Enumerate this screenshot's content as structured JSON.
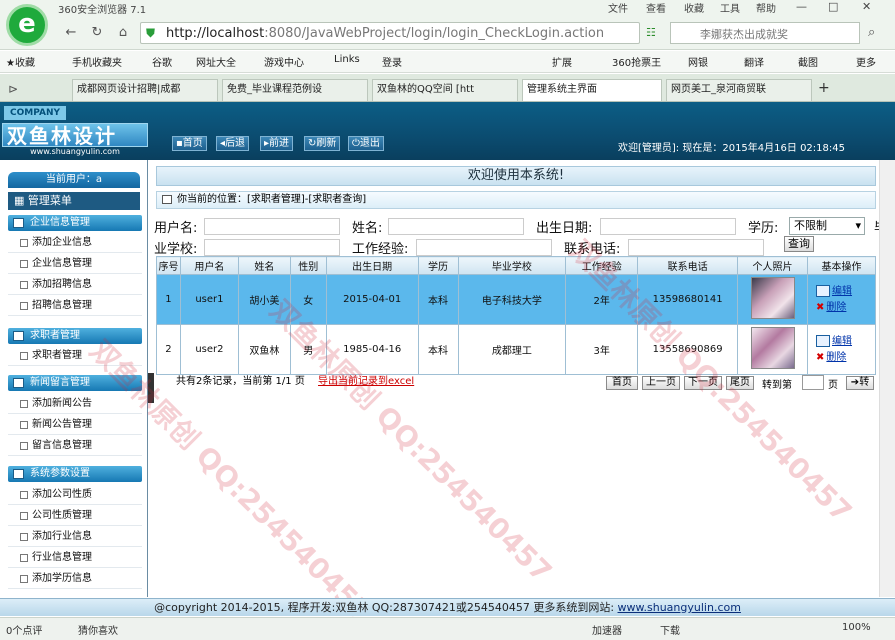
{
  "browser": {
    "title": "360安全浏览器 7.1",
    "menus": [
      "文件",
      "查看",
      "收藏",
      "工具",
      "帮助"
    ],
    "url_host": "http://localhost",
    "url_rest": ":8080/JavaWebProject/login/login_CheckLogin.action",
    "search_text": "李娜获杰出成就奖",
    "favorites": [
      "收藏",
      "手机收藏夹",
      "谷歌",
      "网址大全",
      "游戏中心",
      "Links",
      "登录",
      "扩展",
      "360抢票王",
      "网银",
      "翻译",
      "截图",
      "更多"
    ],
    "tabs": [
      "成都网页设计招聘|成都",
      "免费_毕业课程范例设",
      "双鱼林的QQ空间 [htt",
      "管理系统主界面",
      "网页美工_泉河商贸联"
    ],
    "status": {
      "left1": "0个点评",
      "left2": "猜你喜欢",
      "accel": "加速器",
      "download": "下载",
      "zoom": "100%"
    }
  },
  "header": {
    "company_tag": "COMPANY",
    "brand": "双鱼林设计",
    "brand_url": "www.shuangyulin.com",
    "nav": [
      "首页",
      "后退",
      "前进",
      "刷新",
      "退出"
    ],
    "welcome": "欢迎[管理员]:    现在是：2015年4月16日 02:18:45"
  },
  "sidebar": {
    "current_user": "当前用户：a",
    "menu_title": "管理菜单",
    "groups": [
      {
        "title": "企业信息管理",
        "items": [
          "添加企业信息",
          "企业信息管理",
          "添加招聘信息",
          "招聘信息管理"
        ]
      },
      {
        "title": "求职者管理",
        "items": [
          "求职者管理"
        ]
      },
      {
        "title": "新闻留言管理",
        "items": [
          "添加新闻公告",
          "新闻公告管理",
          "留言信息管理"
        ]
      },
      {
        "title": "系统参数设置",
        "items": [
          "添加公司性质",
          "公司性质管理",
          "添加行业信息",
          "行业信息管理",
          "添加学历信息"
        ]
      }
    ]
  },
  "main": {
    "banner": "欢迎使用本系统!",
    "crumb": "你当前的位置：[求职者管理]-[求职者查询]",
    "filters": {
      "username": "用户名:",
      "name": "姓名:",
      "birth": "出生日期:",
      "edu": "学历:",
      "edu_value": "不限制",
      "school_a": "毕",
      "school_b": "业学校:",
      "exp": "工作经验:",
      "phone": "联系电话:",
      "query": "查询"
    },
    "columns": [
      "序号",
      "用户名",
      "姓名",
      "性别",
      "出生日期",
      "学历",
      "毕业学校",
      "工作经验",
      "联系电话",
      "个人照片",
      "基本操作"
    ],
    "rows": [
      {
        "no": "1",
        "username": "user1",
        "name": "胡小美",
        "gender": "女",
        "birth": "2015-04-01",
        "edu": "本科",
        "school": "电子科技大学",
        "exp": "2年",
        "phone": "13598680141",
        "edit": "编辑",
        "del": "删除"
      },
      {
        "no": "2",
        "username": "user2",
        "name": "双鱼林",
        "gender": "男",
        "birth": "1985-04-16",
        "edu": "本科",
        "school": "成都理工",
        "exp": "3年",
        "phone": "13558690869",
        "edit": "编辑",
        "del": "删除"
      }
    ],
    "pager": {
      "summary": "共有2条记录，当前第 1/1 页",
      "export": "导出当前记录到excel",
      "first": "首页",
      "prev": "上一页",
      "next": "下一页",
      "last": "尾页",
      "goto": "转到第",
      "page": "页",
      "go": "转"
    }
  },
  "footer": {
    "text": "@copyright 2014-2015, 程序开发:双鱼林  QQ:287307421或254540457  更多系统到网站:",
    "site": "www.shuangyulin.com"
  },
  "watermark": "双鱼林原创 QQ:254540457"
}
